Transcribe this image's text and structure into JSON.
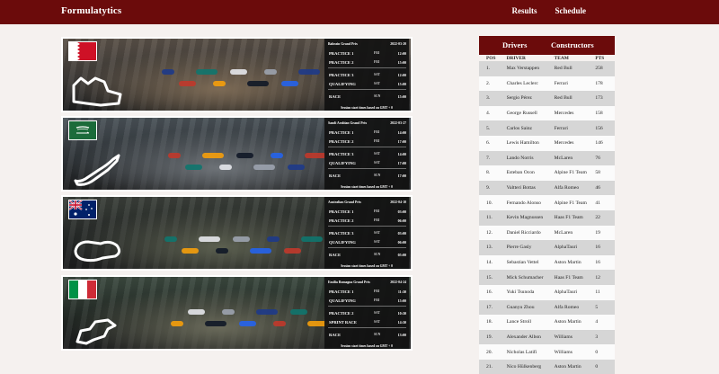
{
  "app": {
    "brand": "Formulatytics",
    "nav": [
      "Results",
      "Schedule"
    ]
  },
  "races": [
    {
      "name": "Bahrain Grand Prix",
      "date": "2022-03-20",
      "flag": "bahrain",
      "sessions": [
        {
          "name": "PRACTICE 1",
          "day": "FRI",
          "time": "12:00"
        },
        {
          "name": "PRACTICE 2",
          "day": "FRI",
          "time": "15:00"
        },
        {
          "name": "PRACTICE 3",
          "day": "SAT",
          "time": "12:00"
        },
        {
          "name": "QUALIFYING",
          "day": "SAT",
          "time": "15:00"
        },
        {
          "name": "RACE",
          "day": "SUN",
          "time": "15:00"
        }
      ],
      "note": "Session start times based on GMT + 0",
      "colors": [
        "#5a5148",
        "#3d3a37",
        "#7c6a55"
      ]
    },
    {
      "name": "Saudi Arabian Grand Prix",
      "date": "2022-03-27",
      "flag": "saudi",
      "sessions": [
        {
          "name": "PRACTICE 1",
          "day": "FRI",
          "time": "14:00"
        },
        {
          "name": "PRACTICE 2",
          "day": "FRI",
          "time": "17:00"
        },
        {
          "name": "PRACTICE 3",
          "day": "SAT",
          "time": "14:00"
        },
        {
          "name": "QUALIFYING",
          "day": "SAT",
          "time": "17:00"
        },
        {
          "name": "RACE",
          "day": "SUN",
          "time": "17:00"
        }
      ],
      "note": "Session start times based on GMT + 0",
      "colors": [
        "#4a5258",
        "#2f3438",
        "#6e7378"
      ]
    },
    {
      "name": "Australian Grand Prix",
      "date": "2022-04-10",
      "flag": "australia",
      "sessions": [
        {
          "name": "PRACTICE 1",
          "day": "FRI",
          "time": "03:00"
        },
        {
          "name": "PRACTICE 2",
          "day": "FRI",
          "time": "06:00"
        },
        {
          "name": "PRACTICE 3",
          "day": "SAT",
          "time": "03:00"
        },
        {
          "name": "QUALIFYING",
          "day": "SAT",
          "time": "06:00"
        },
        {
          "name": "RACE",
          "day": "SUN",
          "time": "05:00"
        }
      ],
      "note": "Session start times based on GMT + 0",
      "colors": [
        "#3b403a",
        "#252827",
        "#5b5f4f"
      ]
    },
    {
      "name": "Emilia Romagna Grand Prix",
      "date": "2022-04-24",
      "flag": "italy",
      "sessions": [
        {
          "name": "PRACTICE 1",
          "day": "FRI",
          "time": "11:30"
        },
        {
          "name": "QUALIFYING",
          "day": "FRI",
          "time": "15:00"
        },
        {
          "name": "PRACTICE 2",
          "day": "SAT",
          "time": "10:30"
        },
        {
          "name": "SPRINT RACE",
          "day": "SAT",
          "time": "14:30"
        },
        {
          "name": "RACE",
          "day": "SUN",
          "time": "13:00"
        }
      ],
      "note": "Session start times based on GMT + 0",
      "colors": [
        "#3c4a40",
        "#222824",
        "#6a6a5a"
      ]
    }
  ],
  "standings": {
    "tabs": [
      "Drivers",
      "Constructors"
    ],
    "headers": [
      "POS",
      "DRIVER",
      "TEAM",
      "PTS"
    ],
    "rows": [
      {
        "pos": "1.",
        "driver": "Max Verstappen",
        "team": "Red Bull",
        "pts": "258"
      },
      {
        "pos": "2.",
        "driver": "Charles Leclerc",
        "team": "Ferrari",
        "pts": "178"
      },
      {
        "pos": "3.",
        "driver": "Sergio Pérez",
        "team": "Red Bull",
        "pts": "173"
      },
      {
        "pos": "4.",
        "driver": "George Russell",
        "team": "Mercedes",
        "pts": "158"
      },
      {
        "pos": "5.",
        "driver": "Carlos Sainz",
        "team": "Ferrari",
        "pts": "156"
      },
      {
        "pos": "6.",
        "driver": "Lewis Hamilton",
        "team": "Mercedes",
        "pts": "146"
      },
      {
        "pos": "7.",
        "driver": "Lando Norris",
        "team": "McLaren",
        "pts": "76"
      },
      {
        "pos": "8.",
        "driver": "Esteban Ocon",
        "team": "Alpine F1 Team",
        "pts": "58"
      },
      {
        "pos": "9.",
        "driver": "Valtteri Bottas",
        "team": "Alfa Romeo",
        "pts": "46"
      },
      {
        "pos": "10.",
        "driver": "Fernando Alonso",
        "team": "Alpine F1 Team",
        "pts": "41"
      },
      {
        "pos": "11.",
        "driver": "Kevin Magnussen",
        "team": "Haas F1 Team",
        "pts": "22"
      },
      {
        "pos": "12.",
        "driver": "Daniel Ricciardo",
        "team": "McLaren",
        "pts": "19"
      },
      {
        "pos": "13.",
        "driver": "Pierre Gasly",
        "team": "AlphaTauri",
        "pts": "16"
      },
      {
        "pos": "14.",
        "driver": "Sebastian Vettel",
        "team": "Aston Martin",
        "pts": "16"
      },
      {
        "pos": "15.",
        "driver": "Mick Schumacher",
        "team": "Haas F1 Team",
        "pts": "12"
      },
      {
        "pos": "16.",
        "driver": "Yuki Tsunoda",
        "team": "AlphaTauri",
        "pts": "11"
      },
      {
        "pos": "17.",
        "driver": "Guanyu Zhou",
        "team": "Alfa Romeo",
        "pts": "5"
      },
      {
        "pos": "18.",
        "driver": "Lance Stroll",
        "team": "Aston Martin",
        "pts": "4"
      },
      {
        "pos": "19.",
        "driver": "Alexander Albon",
        "team": "Williams",
        "pts": "3"
      },
      {
        "pos": "20.",
        "driver": "Nicholas Latifi",
        "team": "Williams",
        "pts": "0"
      },
      {
        "pos": "21.",
        "driver": "Nico Hülkenberg",
        "team": "Aston Martin",
        "pts": "0"
      }
    ]
  },
  "colors": {
    "brand": "#6b0b0b",
    "page": "#f5f1ef",
    "row_alt": "#d6d6d6"
  }
}
